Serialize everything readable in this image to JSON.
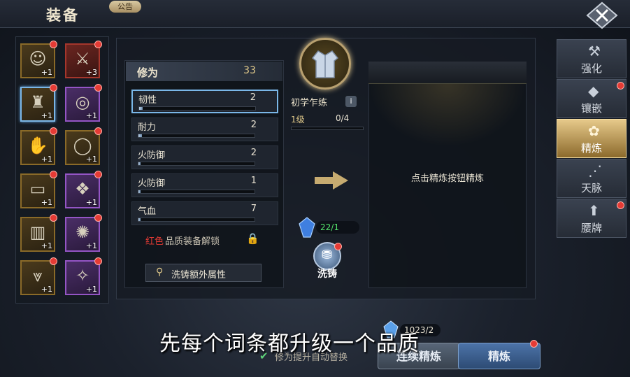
{
  "header": {
    "title": "装备",
    "notice_label": "公告",
    "close_icon": "close-icon"
  },
  "equipment": [
    {
      "name": "avatar",
      "glyph": "☺",
      "level": "+1",
      "rarity": "gold",
      "dot": true
    },
    {
      "name": "spear",
      "glyph": "⚔",
      "level": "+3",
      "rarity": "red",
      "dot": true
    },
    {
      "name": "robe",
      "glyph": "♜",
      "level": "+1",
      "rarity": "gold",
      "selected": true,
      "dot": true
    },
    {
      "name": "ring-pair",
      "glyph": "◎",
      "level": "+1",
      "rarity": "purple",
      "dot": true
    },
    {
      "name": "bracer",
      "glyph": "✋",
      "level": "+1",
      "rarity": "gold",
      "dot": true
    },
    {
      "name": "ring",
      "glyph": "◯",
      "level": "+1",
      "rarity": "gold",
      "dot": true
    },
    {
      "name": "belt",
      "glyph": "▭",
      "level": "+1",
      "rarity": "gold",
      "dot": true
    },
    {
      "name": "necklace",
      "glyph": "❖",
      "level": "+1",
      "rarity": "purple",
      "dot": true
    },
    {
      "name": "leggings",
      "glyph": "▥",
      "level": "+1",
      "rarity": "gold",
      "dot": true
    },
    {
      "name": "pendant",
      "glyph": "✺",
      "level": "+1",
      "rarity": "purple",
      "dot": true
    },
    {
      "name": "boots",
      "glyph": "⩔",
      "level": "+1",
      "rarity": "gold",
      "dot": true
    },
    {
      "name": "charm",
      "glyph": "✧",
      "level": "+1",
      "rarity": "purple",
      "dot": true
    }
  ],
  "attributes": {
    "header_label": "修为",
    "header_value": "33",
    "rows": [
      {
        "label": "韧性",
        "value": "2",
        "fill": 0.03,
        "active": true
      },
      {
        "label": "耐力",
        "value": "2",
        "fill": 0.03
      },
      {
        "label": "火防御",
        "value": "2",
        "fill": 0.02
      },
      {
        "label": "火防御",
        "value": "1",
        "fill": 0.01
      },
      {
        "label": "气血",
        "value": "7",
        "fill": 0.02
      }
    ],
    "unlock_red": "红色",
    "unlock_text": "品质装备解锁",
    "search_label": "洗铸额外属性"
  },
  "middle": {
    "item_name": "初学乍练",
    "info_label": "i",
    "level_label": "1级",
    "level_progress": "0/4",
    "gem_count": "22/1",
    "wash_label": "洗铸"
  },
  "result": {
    "hint": "点击精炼按钮精炼"
  },
  "tabs": [
    {
      "label": "强化",
      "icon": "anvil-icon",
      "glyph": "⚒",
      "dot": false
    },
    {
      "label": "镶嵌",
      "icon": "gem-socket-icon",
      "glyph": "◆",
      "dot": true
    },
    {
      "label": "精炼",
      "icon": "refine-icon",
      "glyph": "✿",
      "active": true,
      "dot": false
    },
    {
      "label": "天脉",
      "icon": "meridian-icon",
      "glyph": "⋰",
      "dot": false
    },
    {
      "label": "腰牌",
      "icon": "token-icon",
      "glyph": "⬆",
      "dot": true
    }
  ],
  "bottom": {
    "auto_text": "修为提升自动替换",
    "gem_cost": "1023/2",
    "batch_label": "连续精炼",
    "refine_label": "精炼"
  },
  "subtitle": "先每个词条都升级一个品质",
  "colors": {
    "accent_gold": "#e0c98a",
    "notify_red": "#e53b35",
    "gem_green": "#54e36b",
    "active_blue": "#7ab7e8"
  }
}
